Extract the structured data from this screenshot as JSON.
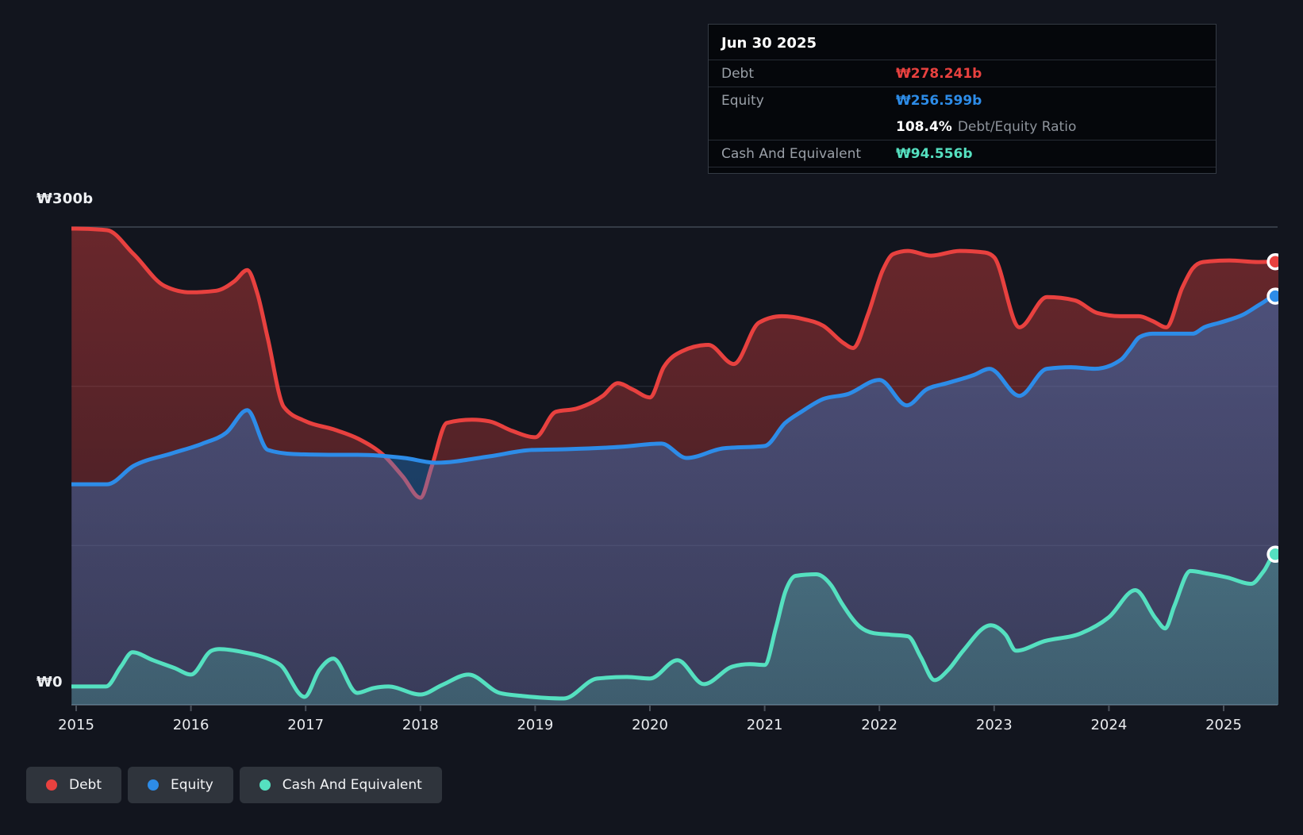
{
  "axis": {
    "y_top_label": "₩300b",
    "y_zero_label": "₩0",
    "x_ticks": [
      2015,
      2016,
      2017,
      2018,
      2019,
      2020,
      2021,
      2022,
      2023,
      2024,
      2025
    ]
  },
  "tooltip": {
    "date": "Jun 30 2025",
    "rows": [
      {
        "label": "Debt",
        "value": "₩278.241b",
        "color": "#e8413f"
      },
      {
        "label": "Equity",
        "value": "₩256.599b",
        "color": "#2d8ce8"
      },
      {
        "label": "Cash And Equivalent",
        "value": "₩94.556b",
        "color": "#55e0c0"
      }
    ],
    "ratio_value": "108.4%",
    "ratio_label": "Debt/Equity Ratio"
  },
  "legend": [
    {
      "label": "Debt",
      "color": "#e8413f"
    },
    {
      "label": "Equity",
      "color": "#2d8ce8"
    },
    {
      "label": "Cash And Equivalent",
      "color": "#55e0c0"
    }
  ],
  "chart_data": {
    "type": "area",
    "title": "Debt to Equity History",
    "unit": "KRW billions",
    "x_range": [
      2015.0,
      2025.5
    ],
    "ylim": [
      0,
      300
    ],
    "grid_values": [
      300,
      200,
      100,
      0
    ],
    "legend_position": "bottom-left",
    "series": [
      {
        "name": "Debt",
        "color": "#e8413f",
        "last_value_label": "₩278.241b",
        "points": [
          [
            2014.96,
            299
          ],
          [
            2015.0,
            299
          ],
          [
            2015.27,
            298
          ],
          [
            2015.5,
            283
          ],
          [
            2015.77,
            263
          ],
          [
            2016.0,
            259
          ],
          [
            2016.22,
            260
          ],
          [
            2016.38,
            266
          ],
          [
            2016.49,
            273
          ],
          [
            2016.58,
            258
          ],
          [
            2016.67,
            230
          ],
          [
            2016.81,
            187
          ],
          [
            2017.0,
            178
          ],
          [
            2017.24,
            173
          ],
          [
            2017.46,
            167
          ],
          [
            2017.69,
            156
          ],
          [
            2017.85,
            143
          ],
          [
            2018.0,
            130
          ],
          [
            2018.1,
            150
          ],
          [
            2018.23,
            177
          ],
          [
            2018.45,
            179
          ],
          [
            2018.6,
            178
          ],
          [
            2018.8,
            172
          ],
          [
            2019.0,
            168
          ],
          [
            2019.18,
            184
          ],
          [
            2019.36,
            186
          ],
          [
            2019.59,
            194
          ],
          [
            2019.72,
            202
          ],
          [
            2019.85,
            198
          ],
          [
            2020.0,
            193
          ],
          [
            2020.12,
            212
          ],
          [
            2020.28,
            222
          ],
          [
            2020.51,
            226
          ],
          [
            2020.73,
            214
          ],
          [
            2020.95,
            240
          ],
          [
            2021.15,
            244
          ],
          [
            2021.35,
            242
          ],
          [
            2021.51,
            238
          ],
          [
            2021.69,
            227
          ],
          [
            2021.77,
            224
          ],
          [
            2021.9,
            245
          ],
          [
            2022.03,
            273
          ],
          [
            2022.12,
            283
          ],
          [
            2022.25,
            285
          ],
          [
            2022.45,
            282
          ],
          [
            2022.7,
            285
          ],
          [
            2022.92,
            284
          ],
          [
            2023.0,
            281
          ],
          [
            2023.22,
            237
          ],
          [
            2023.46,
            256
          ],
          [
            2023.7,
            254
          ],
          [
            2023.9,
            246
          ],
          [
            2024.1,
            244
          ],
          [
            2024.26,
            244
          ],
          [
            2024.38,
            241
          ],
          [
            2024.5,
            237
          ],
          [
            2024.64,
            262
          ],
          [
            2024.73,
            274
          ],
          [
            2024.82,
            278
          ],
          [
            2025.05,
            279
          ],
          [
            2025.3,
            278
          ],
          [
            2025.45,
            278.241
          ]
        ]
      },
      {
        "name": "Equity",
        "color": "#2d8ce8",
        "last_value_label": "₩256.599b",
        "points": [
          [
            2014.96,
            138.5
          ],
          [
            2015.0,
            138.5
          ],
          [
            2015.27,
            138.5
          ],
          [
            2015.5,
            150
          ],
          [
            2015.84,
            158
          ],
          [
            2016.1,
            164
          ],
          [
            2016.31,
            171
          ],
          [
            2016.49,
            185
          ],
          [
            2016.67,
            160
          ],
          [
            2016.89,
            157.5
          ],
          [
            2017.2,
            157
          ],
          [
            2017.45,
            157
          ],
          [
            2017.86,
            155
          ],
          [
            2018.14,
            152
          ],
          [
            2018.6,
            156
          ],
          [
            2018.97,
            160
          ],
          [
            2019.29,
            160.5
          ],
          [
            2019.75,
            162
          ],
          [
            2020.1,
            164
          ],
          [
            2020.32,
            155
          ],
          [
            2020.64,
            161
          ],
          [
            2021.0,
            162.5
          ],
          [
            2021.18,
            177
          ],
          [
            2021.32,
            184
          ],
          [
            2021.51,
            192
          ],
          [
            2021.72,
            195
          ],
          [
            2022.0,
            204
          ],
          [
            2022.24,
            188
          ],
          [
            2022.41,
            198
          ],
          [
            2022.59,
            202
          ],
          [
            2022.82,
            207
          ],
          [
            2022.96,
            211
          ],
          [
            2023.22,
            194
          ],
          [
            2023.46,
            211
          ],
          [
            2023.67,
            212
          ],
          [
            2023.88,
            211
          ],
          [
            2024.11,
            217
          ],
          [
            2024.18,
            223
          ],
          [
            2024.27,
            231
          ],
          [
            2024.38,
            233
          ],
          [
            2024.6,
            233
          ],
          [
            2024.73,
            233
          ],
          [
            2024.83,
            237
          ],
          [
            2024.97,
            240
          ],
          [
            2025.17,
            245
          ],
          [
            2025.33,
            252
          ],
          [
            2025.45,
            256.599
          ]
        ]
      },
      {
        "name": "Cash And Equivalent",
        "color": "#55e0c0",
        "last_value_label": "₩94.556b",
        "points": [
          [
            2014.96,
            11.5
          ],
          [
            2015.0,
            11.5
          ],
          [
            2015.26,
            11.5
          ],
          [
            2015.39,
            24
          ],
          [
            2015.49,
            33
          ],
          [
            2015.67,
            28
          ],
          [
            2015.86,
            23
          ],
          [
            2016.0,
            19
          ],
          [
            2016.18,
            34
          ],
          [
            2016.25,
            35
          ],
          [
            2016.46,
            33
          ],
          [
            2016.67,
            29
          ],
          [
            2016.78,
            25
          ],
          [
            2016.99,
            5
          ],
          [
            2017.12,
            22
          ],
          [
            2017.24,
            29
          ],
          [
            2017.45,
            7.5
          ],
          [
            2017.59,
            10.5
          ],
          [
            2017.72,
            11.5
          ],
          [
            2018.0,
            6.5
          ],
          [
            2018.19,
            12.5
          ],
          [
            2018.42,
            19
          ],
          [
            2018.69,
            7.5
          ],
          [
            2018.9,
            5.5
          ],
          [
            2019.25,
            4
          ],
          [
            2019.54,
            16.5
          ],
          [
            2019.8,
            17.5
          ],
          [
            2020.0,
            16.5
          ],
          [
            2020.24,
            28
          ],
          [
            2020.47,
            13
          ],
          [
            2020.72,
            24
          ],
          [
            2020.87,
            25.5
          ],
          [
            2021.0,
            25
          ],
          [
            2021.1,
            49
          ],
          [
            2021.18,
            71
          ],
          [
            2021.27,
            81
          ],
          [
            2021.45,
            82
          ],
          [
            2021.58,
            75
          ],
          [
            2021.67,
            64
          ],
          [
            2021.83,
            49
          ],
          [
            2021.95,
            45
          ],
          [
            2022.1,
            44
          ],
          [
            2022.25,
            43
          ],
          [
            2022.36,
            30
          ],
          [
            2022.48,
            15.5
          ],
          [
            2022.6,
            22
          ],
          [
            2022.73,
            34
          ],
          [
            2022.97,
            50
          ],
          [
            2023.1,
            44
          ],
          [
            2023.19,
            34
          ],
          [
            2023.44,
            40
          ],
          [
            2023.76,
            45
          ],
          [
            2024.0,
            55
          ],
          [
            2024.23,
            72
          ],
          [
            2024.41,
            54
          ],
          [
            2024.49,
            48
          ],
          [
            2024.57,
            62
          ],
          [
            2024.71,
            84
          ],
          [
            2024.85,
            82.5
          ],
          [
            2025.03,
            80
          ],
          [
            2025.24,
            76
          ],
          [
            2025.35,
            84
          ],
          [
            2025.45,
            94.556
          ]
        ]
      }
    ]
  }
}
